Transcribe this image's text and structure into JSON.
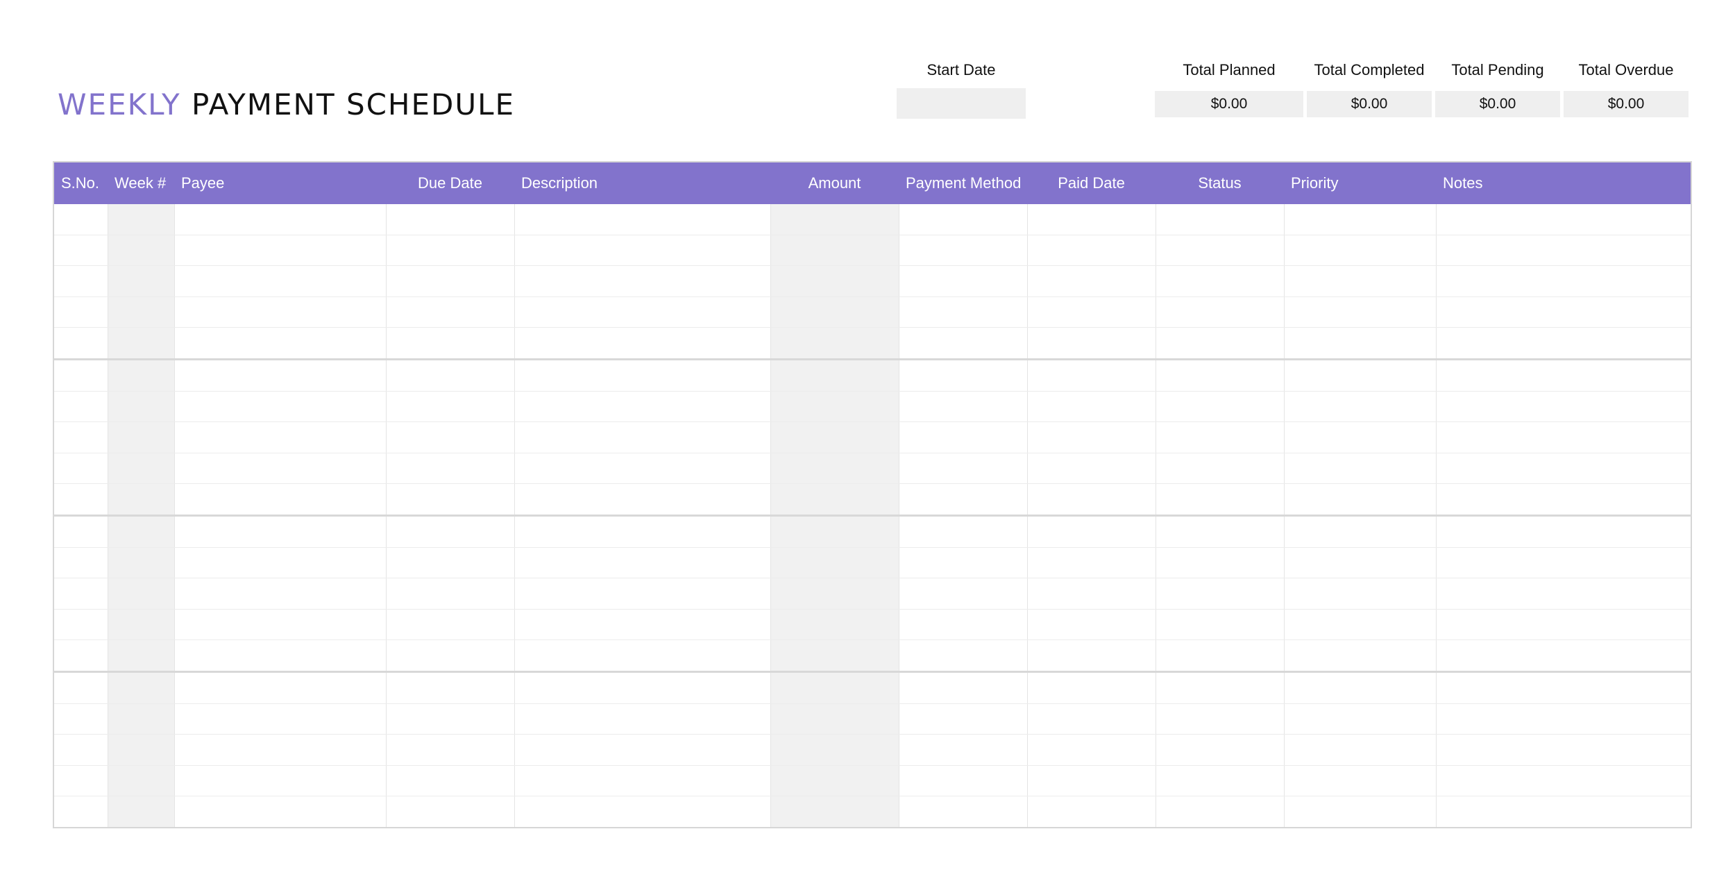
{
  "title": {
    "accent": "WEEKLY",
    "main": "PAYMENT SCHEDULE"
  },
  "summary": {
    "start_date": {
      "label": "Start Date",
      "value": ""
    },
    "totals": [
      {
        "key": "planned",
        "label": "Total Planned",
        "value": "$0.00"
      },
      {
        "key": "completed",
        "label": "Total Completed",
        "value": "$0.00"
      },
      {
        "key": "pending",
        "label": "Total Pending",
        "value": "$0.00"
      },
      {
        "key": "overdue",
        "label": "Total Overdue",
        "value": "$0.00"
      }
    ]
  },
  "table": {
    "columns": [
      {
        "key": "sno",
        "label": "S.No.",
        "align": "left",
        "shaded": false
      },
      {
        "key": "week",
        "label": "Week #",
        "align": "left",
        "shaded": true
      },
      {
        "key": "payee",
        "label": "Payee",
        "align": "left",
        "shaded": false
      },
      {
        "key": "due_date",
        "label": "Due Date",
        "align": "center",
        "shaded": false
      },
      {
        "key": "description",
        "label": "Description",
        "align": "left",
        "shaded": false
      },
      {
        "key": "amount",
        "label": "Amount",
        "align": "center",
        "shaded": true
      },
      {
        "key": "payment_method",
        "label": "Payment Method",
        "align": "center",
        "shaded": false
      },
      {
        "key": "paid_date",
        "label": "Paid Date",
        "align": "center",
        "shaded": false
      },
      {
        "key": "status",
        "label": "Status",
        "align": "center",
        "shaded": false
      },
      {
        "key": "priority",
        "label": "Priority",
        "align": "left",
        "shaded": false
      },
      {
        "key": "notes",
        "label": "Notes",
        "align": "left",
        "shaded": false
      }
    ],
    "groups": [
      {
        "rows": [
          [
            "",
            "",
            "",
            "",
            "",
            "",
            "",
            "",
            "",
            "",
            ""
          ],
          [
            "",
            "",
            "",
            "",
            "",
            "",
            "",
            "",
            "",
            "",
            ""
          ],
          [
            "",
            "",
            "",
            "",
            "",
            "",
            "",
            "",
            "",
            "",
            ""
          ],
          [
            "",
            "",
            "",
            "",
            "",
            "",
            "",
            "",
            "",
            "",
            ""
          ],
          [
            "",
            "",
            "",
            "",
            "",
            "",
            "",
            "",
            "",
            "",
            ""
          ]
        ]
      },
      {
        "rows": [
          [
            "",
            "",
            "",
            "",
            "",
            "",
            "",
            "",
            "",
            "",
            ""
          ],
          [
            "",
            "",
            "",
            "",
            "",
            "",
            "",
            "",
            "",
            "",
            ""
          ],
          [
            "",
            "",
            "",
            "",
            "",
            "",
            "",
            "",
            "",
            "",
            ""
          ],
          [
            "",
            "",
            "",
            "",
            "",
            "",
            "",
            "",
            "",
            "",
            ""
          ],
          [
            "",
            "",
            "",
            "",
            "",
            "",
            "",
            "",
            "",
            "",
            ""
          ]
        ]
      },
      {
        "rows": [
          [
            "",
            "",
            "",
            "",
            "",
            "",
            "",
            "",
            "",
            "",
            ""
          ],
          [
            "",
            "",
            "",
            "",
            "",
            "",
            "",
            "",
            "",
            "",
            ""
          ],
          [
            "",
            "",
            "",
            "",
            "",
            "",
            "",
            "",
            "",
            "",
            ""
          ],
          [
            "",
            "",
            "",
            "",
            "",
            "",
            "",
            "",
            "",
            "",
            ""
          ],
          [
            "",
            "",
            "",
            "",
            "",
            "",
            "",
            "",
            "",
            "",
            ""
          ]
        ]
      },
      {
        "rows": [
          [
            "",
            "",
            "",
            "",
            "",
            "",
            "",
            "",
            "",
            "",
            ""
          ],
          [
            "",
            "",
            "",
            "",
            "",
            "",
            "",
            "",
            "",
            "",
            ""
          ],
          [
            "",
            "",
            "",
            "",
            "",
            "",
            "",
            "",
            "",
            "",
            ""
          ],
          [
            "",
            "",
            "",
            "",
            "",
            "",
            "",
            "",
            "",
            "",
            ""
          ],
          [
            "",
            "",
            "",
            "",
            "",
            "",
            "",
            "",
            "",
            "",
            ""
          ]
        ]
      }
    ]
  },
  "colors": {
    "accent": "#8273cc",
    "shaded_cell": "#f1f1f1",
    "border": "#d6d6d6"
  }
}
